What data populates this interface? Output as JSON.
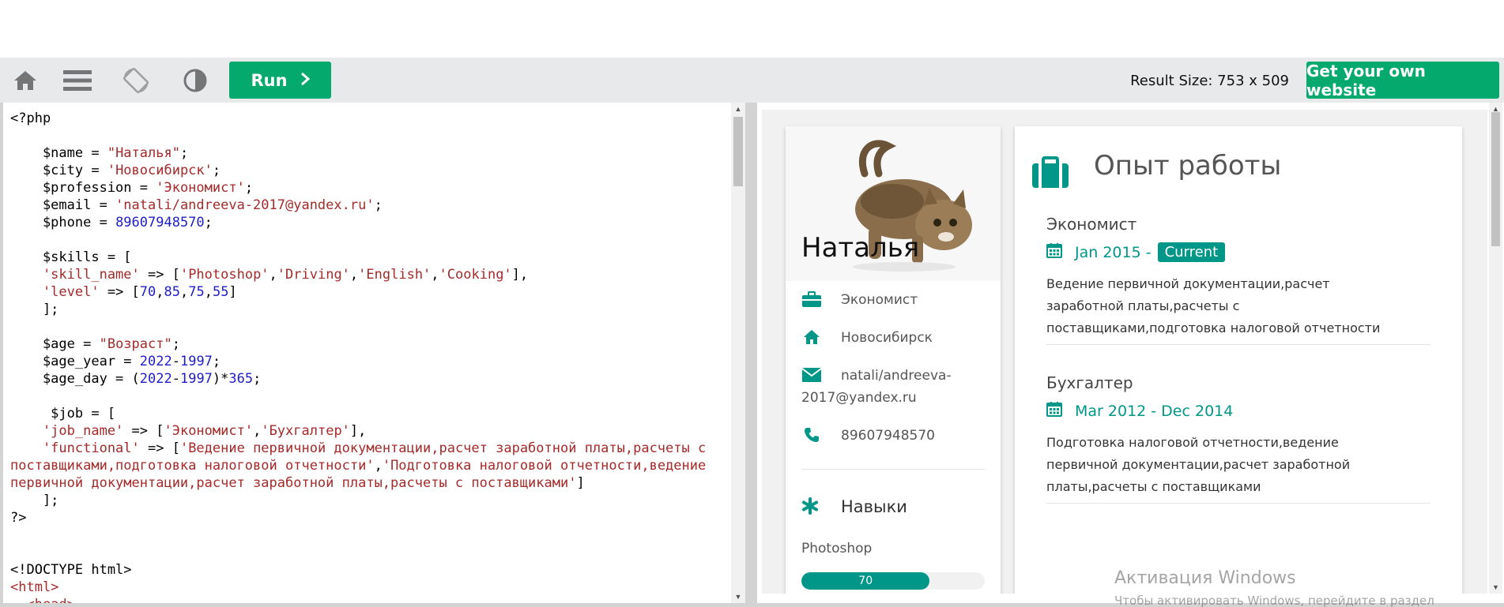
{
  "toolbar": {
    "home_icon": "home-icon",
    "menu_icon": "menu-icon",
    "rotate_icon": "rotate-icon",
    "theme_icon": "contrast-icon",
    "run_label": "Run",
    "result_size": "Result Size: 753 x 509",
    "own_website_label": "Get your own website"
  },
  "code_lines": [
    [
      [
        "v",
        "<?php"
      ]
    ],
    [],
    [
      [
        "v",
        "    $name = "
      ],
      [
        "s",
        "\"Наталья\""
      ],
      [
        "v",
        ";"
      ]
    ],
    [
      [
        "v",
        "    $city = "
      ],
      [
        "s",
        "'Новосибирск'"
      ],
      [
        "v",
        ";"
      ]
    ],
    [
      [
        "v",
        "    $profession = "
      ],
      [
        "s",
        "'Экономист'"
      ],
      [
        "v",
        ";"
      ]
    ],
    [
      [
        "v",
        "    $email = "
      ],
      [
        "s",
        "'natali/andreeva-2017@yandex.ru'"
      ],
      [
        "v",
        ";"
      ]
    ],
    [
      [
        "v",
        "    $phone = "
      ],
      [
        "n",
        "89607948570"
      ],
      [
        "v",
        ";"
      ]
    ],
    [],
    [
      [
        "v",
        "    $skills = ["
      ]
    ],
    [
      [
        "s",
        "    'skill_name'"
      ],
      [
        "v",
        " => ["
      ],
      [
        "s",
        "'Photoshop'"
      ],
      [
        "v",
        ","
      ],
      [
        "s",
        "'Driving'"
      ],
      [
        "v",
        ","
      ],
      [
        "s",
        "'English'"
      ],
      [
        "v",
        ","
      ],
      [
        "s",
        "'Cooking'"
      ],
      [
        "v",
        "],"
      ]
    ],
    [
      [
        "s",
        "    'level'"
      ],
      [
        "v",
        " => ["
      ],
      [
        "n",
        "70"
      ],
      [
        "v",
        ","
      ],
      [
        "n",
        "85"
      ],
      [
        "v",
        ","
      ],
      [
        "n",
        "75"
      ],
      [
        "v",
        ","
      ],
      [
        "n",
        "55"
      ],
      [
        "v",
        "]"
      ]
    ],
    [
      [
        "v",
        "    ];"
      ]
    ],
    [],
    [
      [
        "v",
        "    $age = "
      ],
      [
        "s",
        "\"Возраст\""
      ],
      [
        "v",
        ";"
      ]
    ],
    [
      [
        "v",
        "    $age_year = "
      ],
      [
        "n",
        "2022"
      ],
      [
        "v",
        "-"
      ],
      [
        "n",
        "1997"
      ],
      [
        "v",
        ";"
      ]
    ],
    [
      [
        "v",
        "    $age_day = ("
      ],
      [
        "n",
        "2022"
      ],
      [
        "v",
        "-"
      ],
      [
        "n",
        "1997"
      ],
      [
        "v",
        ")*"
      ],
      [
        "n",
        "365"
      ],
      [
        "v",
        ";"
      ]
    ],
    [],
    [
      [
        "v",
        "     $job = ["
      ]
    ],
    [
      [
        "s",
        "    'job_name'"
      ],
      [
        "v",
        " => ["
      ],
      [
        "s",
        "'Экономист'"
      ],
      [
        "v",
        ","
      ],
      [
        "s",
        "'Бухгалтер'"
      ],
      [
        "v",
        "],"
      ]
    ],
    [
      [
        "s",
        "    'functional'"
      ],
      [
        "v",
        " => ["
      ],
      [
        "s",
        "'Ведение первичной документации,расчет заработной платы,расчеты с"
      ]
    ],
    [
      [
        "s",
        "поставщиками,подготовка налоговой отчетности'"
      ],
      [
        "v",
        ","
      ],
      [
        "s",
        "'Подготовка налоговой отчетности,ведение"
      ]
    ],
    [
      [
        "s",
        "первичной документации,расчет заработной платы,расчеты с поставщиками'"
      ],
      [
        "v",
        "]"
      ]
    ],
    [
      [
        "v",
        "    ];"
      ]
    ],
    [
      [
        "v",
        "?>"
      ]
    ],
    [],
    [],
    [
      [
        "v",
        "<!DOCTYPE html>"
      ]
    ],
    [
      [
        "t",
        "<html>"
      ]
    ],
    [
      [
        "t",
        "  <head>"
      ]
    ]
  ],
  "resume": {
    "name": "Наталья",
    "profession": "Экономист",
    "city": "Новосибирск",
    "email_line1": "natali/andreeva-",
    "email_line2": "2017@yandex.ru",
    "phone": "89607948570",
    "skills_title": "Навыки",
    "skill_name": "Photoshop",
    "skill_level": 70,
    "skill_level_label": "70",
    "section_title": "Опыт работы",
    "jobs": [
      {
        "title": "Экономист",
        "date": "Jan 2015 -",
        "badge": "Current",
        "desc": "Ведение первичной документации,расчет заработной платы,расчеты с поставщиками,подготовка налоговой отчетности"
      },
      {
        "title": "Бухгалтер",
        "date": "Mar 2012 - Dec 2014",
        "desc": "Подготовка налоговой отчетности,ведение первичной документации,расчет заработной платы,расчеты с поставщиками"
      }
    ]
  },
  "watermark": {
    "title": "Активация Windows",
    "subtitle": "Чтобы активировать Windows, перейдите в раздел"
  },
  "colors": {
    "accent_green": "#04aa6d",
    "teal": "#009688",
    "toolbar_bg": "#e7e9eb"
  }
}
